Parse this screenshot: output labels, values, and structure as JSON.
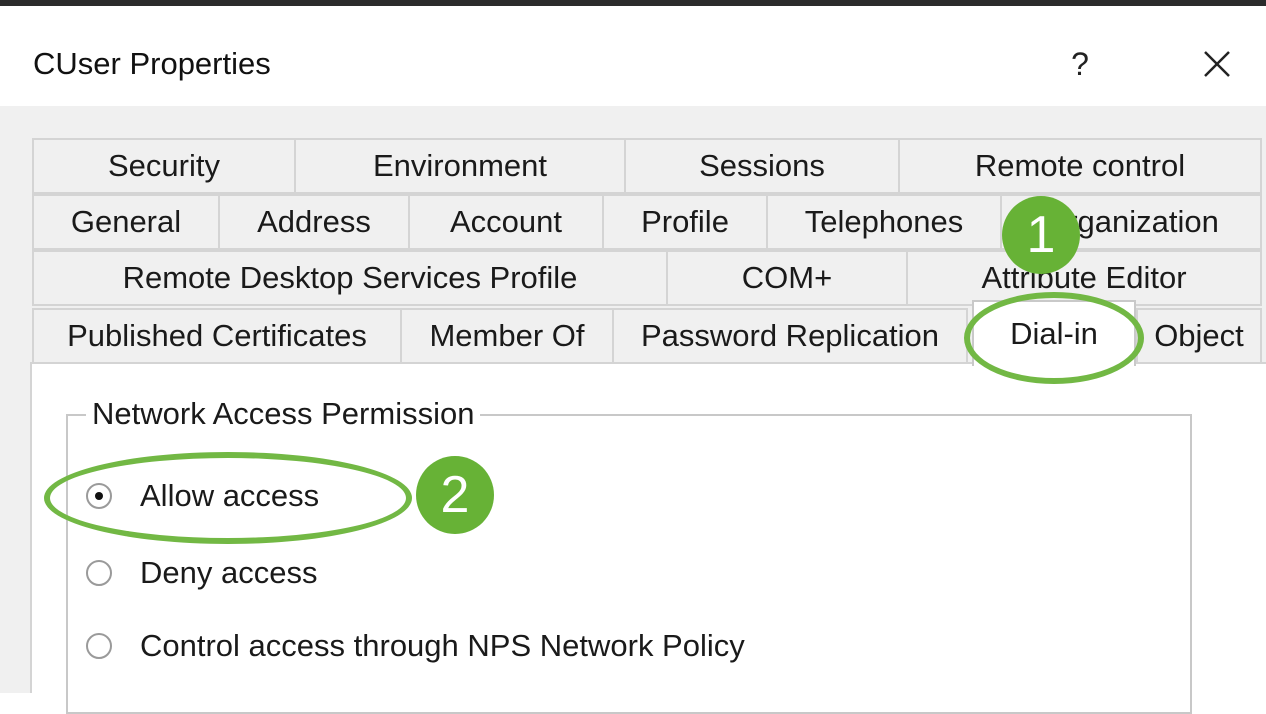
{
  "window": {
    "title": "CUser Properties",
    "help_label": "?",
    "close_icon": "close-icon"
  },
  "tabs": {
    "row1": [
      "Security",
      "Environment",
      "Sessions",
      "Remote control"
    ],
    "row2": [
      "General",
      "Address",
      "Account",
      "Profile",
      "Telephones",
      "Organization"
    ],
    "row3": [
      "Remote Desktop Services Profile",
      "COM+",
      "Attribute Editor"
    ],
    "row4": [
      "Published Certificates",
      "Member Of",
      "Password Replication",
      "Dial-in",
      "Object"
    ],
    "selected": "Dial-in"
  },
  "network_access": {
    "group_title": "Network Access Permission",
    "options": [
      {
        "label": "Allow access",
        "checked": true
      },
      {
        "label": "Deny access",
        "checked": false
      },
      {
        "label": "Control access through NPS Network Policy",
        "checked": false
      }
    ]
  },
  "annotations": {
    "step1": "1",
    "step2": "2",
    "highlight_color": "#72b844",
    "badge_color": "#67b236"
  }
}
